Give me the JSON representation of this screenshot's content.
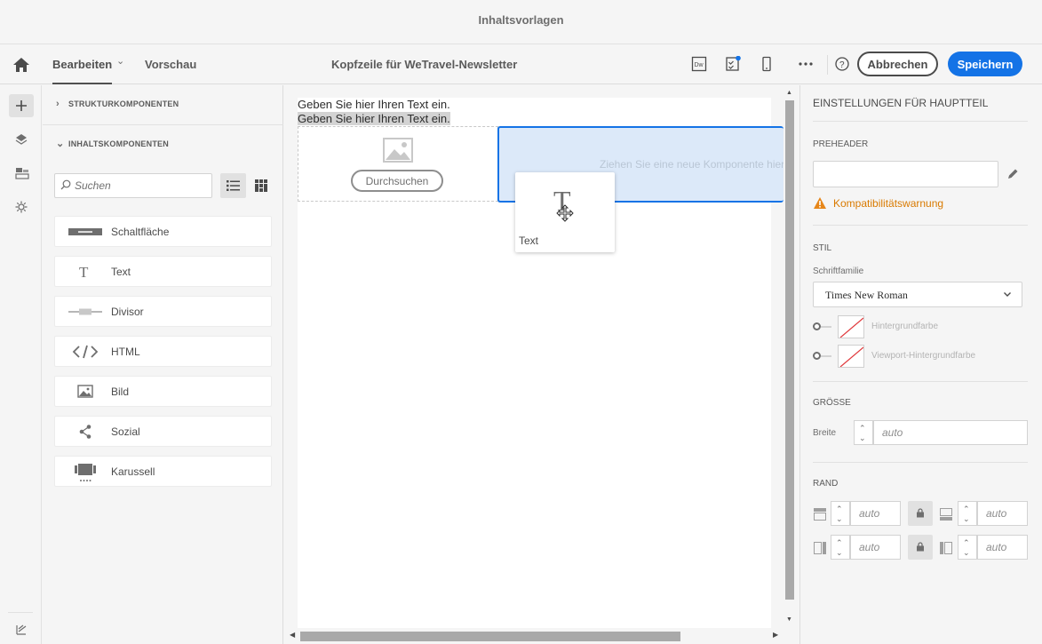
{
  "window_title": "Inhaltsvorlagen",
  "toolbar": {
    "edit_tab": "Bearbeiten",
    "preview_tab": "Vorschau",
    "document_title": "Kopfzeile für WeTravel-Newsletter",
    "cancel_label": "Abbrechen",
    "save_label": "Speichern",
    "icons": [
      "home-icon",
      "dreamweaver-icon",
      "checklist-icon",
      "mobile-icon",
      "more-icon",
      "help-icon"
    ],
    "accent_color": "#1473e6"
  },
  "rail": {
    "icons": [
      "add-icon",
      "layers-icon",
      "fragments-icon",
      "settings-icon",
      "learn-icon"
    ]
  },
  "components_panel": {
    "structure_header": "STRUKTURKOMPONENTEN",
    "content_header": "INHALTSKOMPONENTEN",
    "search_placeholder": "Suchen",
    "items": [
      {
        "label": "Schaltfläche",
        "icon": "button-icon"
      },
      {
        "label": "Text",
        "icon": "text-icon"
      },
      {
        "label": "Divisor",
        "icon": "divider-icon"
      },
      {
        "label": "HTML",
        "icon": "html-icon"
      },
      {
        "label": "Bild",
        "icon": "image-icon"
      },
      {
        "label": "Sozial",
        "icon": "share-icon"
      },
      {
        "label": "Karussell",
        "icon": "carousel-icon"
      }
    ]
  },
  "canvas": {
    "text_line_1": "Geben Sie hier Ihren Text ein.",
    "text_line_2": "Geben Sie hier Ihren Text ein.",
    "browse_label": "Durchsuchen",
    "drop_hint": "Ziehen Sie eine neue Komponente hierher",
    "drag_label": "Text"
  },
  "settings": {
    "title": "EINSTELLUNGEN FÜR HAUPTTEIL",
    "preheader_label": "PREHEADER",
    "preheader_value": "",
    "warning": "Kompatibilitätswarnung",
    "warning_color": "#d97a00",
    "style_label": "STIL",
    "font_family_label": "Schriftfamilie",
    "font_family_value": "Times New Roman",
    "bg_color_label": "Hintergrundfarbe",
    "viewport_bg_label": "Viewport-Hintergrundfarbe",
    "size_label": "GRÖSSE",
    "width_label": "Breite",
    "width_placeholder": "auto",
    "margin_label": "RAND",
    "margin_top_placeholder": "auto",
    "margin_bottom_placeholder": "auto",
    "margin_left_placeholder": "auto",
    "margin_right_placeholder": "auto"
  }
}
